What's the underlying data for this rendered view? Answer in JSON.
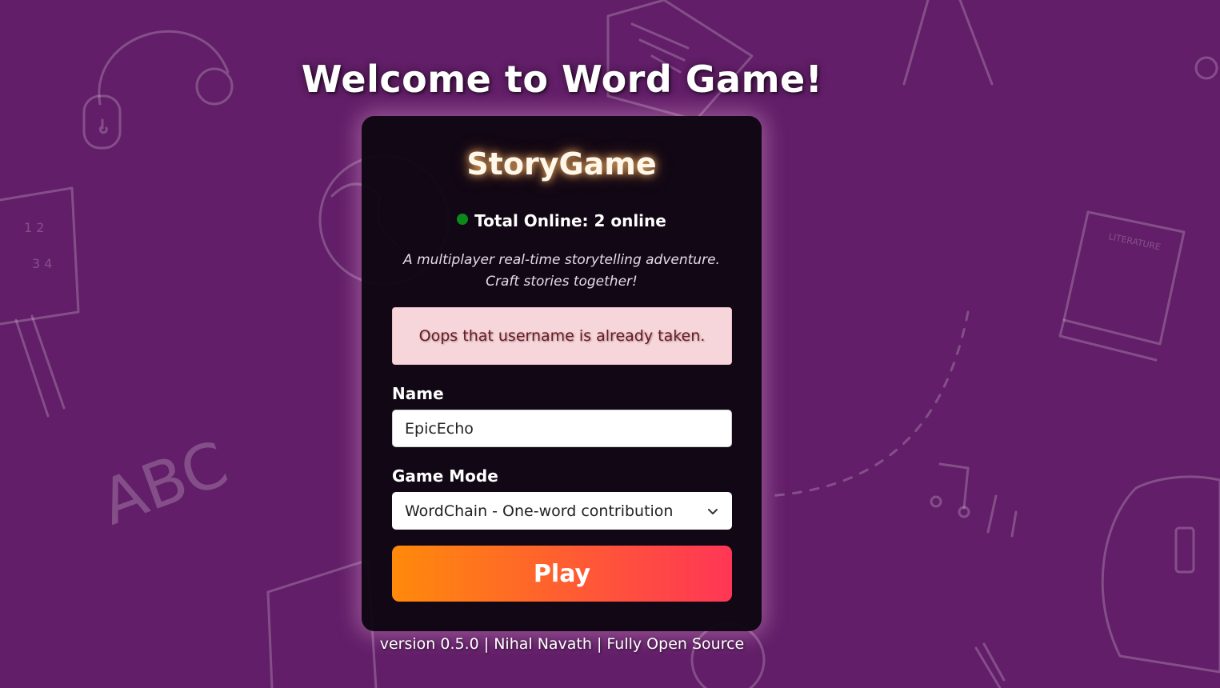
{
  "header": {
    "welcome_title": "Welcome to Word Game!"
  },
  "card": {
    "brand": "StoryGame",
    "online_text": "Total Online: 2 online",
    "tagline_line1": "A multiplayer real-time storytelling adventure.",
    "tagline_line2": "Craft stories together!",
    "error_message": "Oops that username is already taken."
  },
  "form": {
    "name_label": "Name",
    "name_value": "EpicEcho",
    "mode_label": "Game Mode",
    "mode_selected": "WordChain - One-word contribution",
    "play_label": "Play"
  },
  "footer": {
    "text": "version 0.5.0 | Nihal Navath | Fully Open Source"
  },
  "background": {
    "doodle_text_abc": "ABC",
    "doodle_text_literature": "LITERATURE"
  },
  "colors": {
    "background": "#621e68",
    "card": "#0c0610",
    "online_dot": "#0b8a1b",
    "alert_bg": "#f6d6da",
    "alert_text": "#6b1a22",
    "play_gradient_start": "#ff8a0a",
    "play_gradient_end": "#ff3656"
  },
  "icons": {
    "status": "online-dot-icon",
    "select": "chevron-down-icon"
  }
}
